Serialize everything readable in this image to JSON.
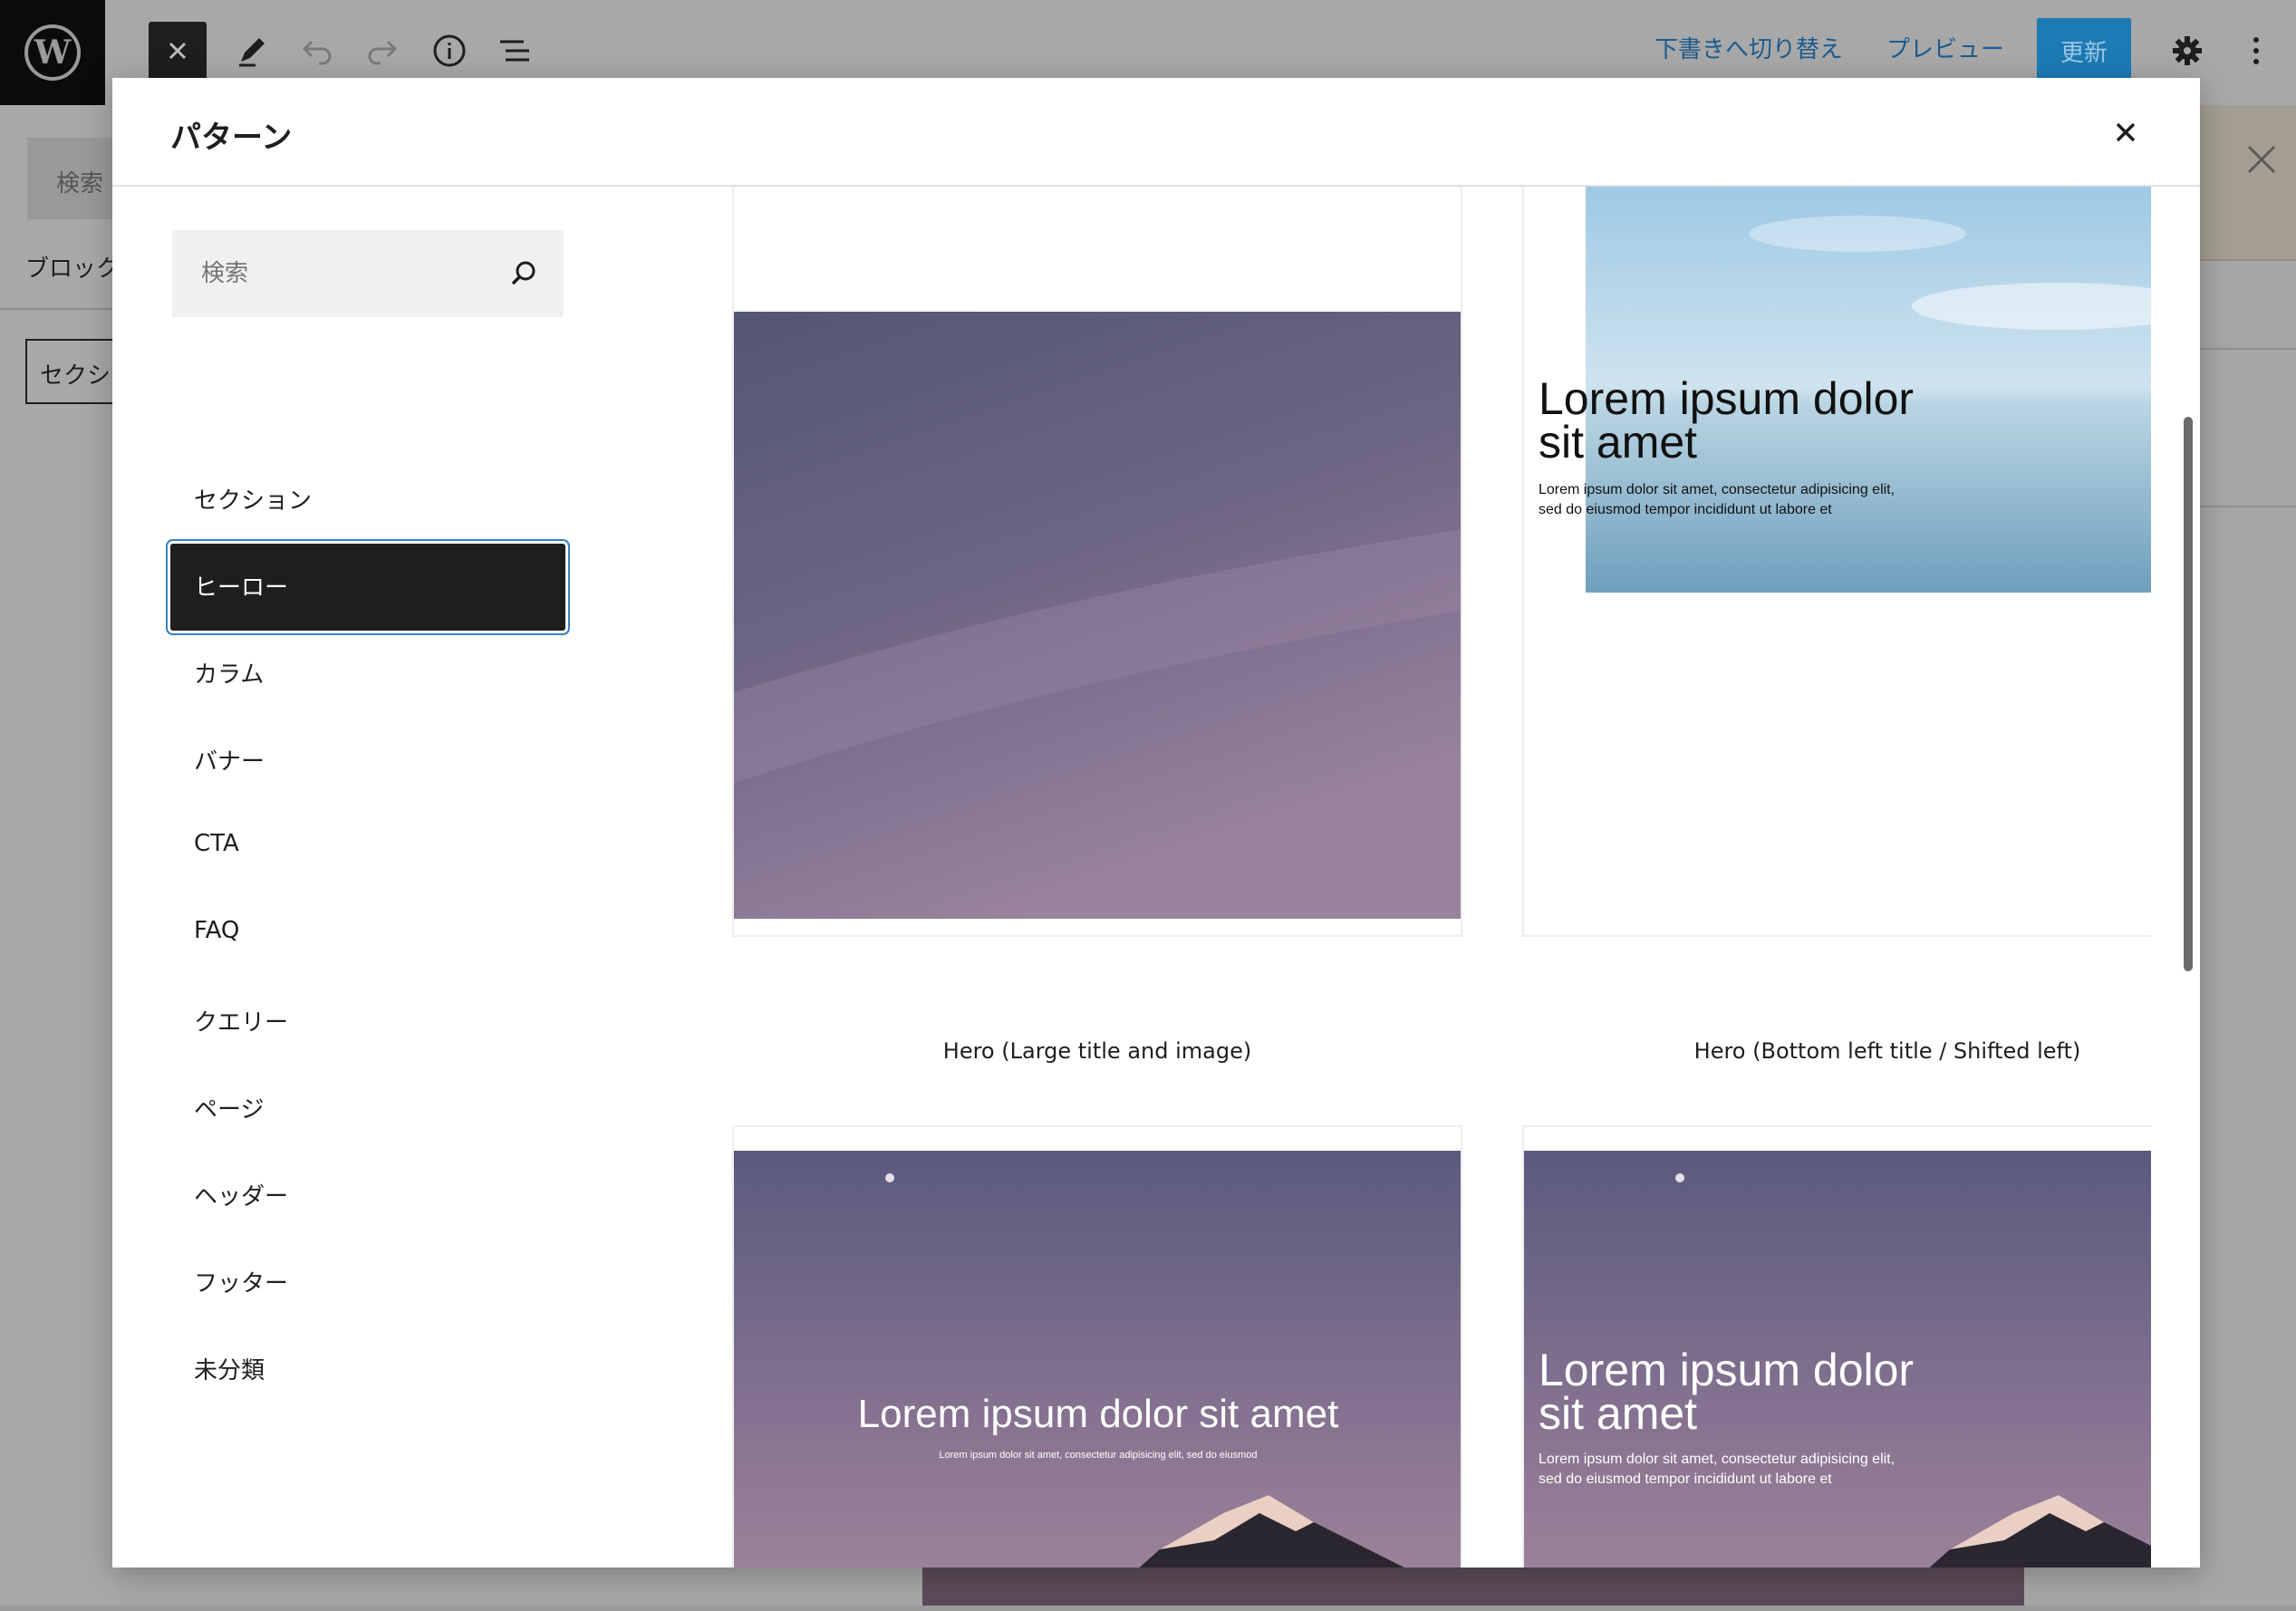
{
  "toolbar": {
    "switch_to_draft": "下書きへ切り替え",
    "preview": "プレビュー",
    "update": "更新"
  },
  "background": {
    "search_label": "検索",
    "block_label": "ブロック",
    "section_box": "セクシ"
  },
  "modal": {
    "title": "パターン",
    "search_placeholder": "検索",
    "categories": [
      {
        "label": "セクション"
      },
      {
        "label": "ヒーロー"
      },
      {
        "label": "カラム"
      },
      {
        "label": "バナー"
      },
      {
        "label": "CTA"
      },
      {
        "label": "FAQ"
      },
      {
        "label": "クエリー"
      },
      {
        "label": "ページ"
      },
      {
        "label": "ヘッダー"
      },
      {
        "label": "フッター"
      },
      {
        "label": "未分類"
      }
    ],
    "active_category": "ヒーロー",
    "patterns": [
      {
        "label": "Hero (Large title and image)"
      },
      {
        "label": "Hero (Bottom left title / Shifted left)",
        "title": "Lorem ipsum dolor sit amet",
        "body": "Lorem ipsum dolor sit amet, consectetur adipisicing elit, sed do eiusmod tempor incididunt ut labore et"
      },
      {
        "title": "Lorem ipsum dolor sit amet",
        "body": "Lorem ipsum dolor sit amet, consectetur adipisicing elit, sed do eiusmod"
      },
      {
        "title": "Lorem ipsum dolor sit amet",
        "body": "Lorem ipsum dolor sit amet, consectetur adipisicing elit, sed do eiusmod tempor incididunt ut labore et"
      }
    ]
  },
  "colors": {
    "accent": "#3582c4",
    "update_button": "#1c7ab5",
    "active_category_bg": "#1e1e1e"
  }
}
